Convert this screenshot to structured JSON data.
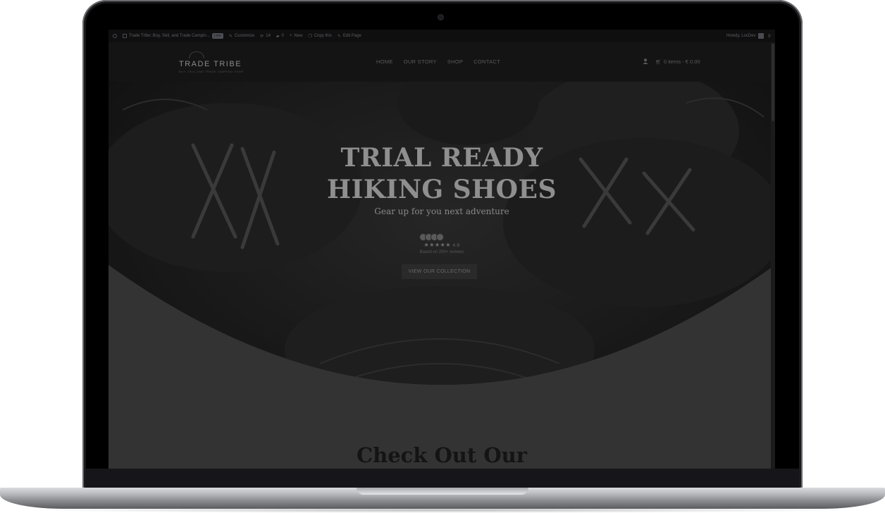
{
  "admin_bar": {
    "site_name": "Trade Tribe: Buy, Sell, and Trade Campin...",
    "live_badge": "Live",
    "customize": "Customize",
    "updates_count": "14",
    "comments_count": "0",
    "new": "New",
    "copy_this": "Copy this",
    "edit_page": "Edit Page",
    "howdy": "Howdy, LocDev"
  },
  "header": {
    "logo": "TRADE TRIBE",
    "tagline": "BUY, SELL AND TRADE CAMPING GEAR",
    "nav": [
      "HOME",
      "OUR STORY",
      "SHOP",
      "CONTACT"
    ],
    "cart": "0 items - € 0.00"
  },
  "hero": {
    "title_line1": "TRIAL READY",
    "title_line2": "HIKING SHOES",
    "subtitle": "Gear up for you next adventure",
    "stars": "★★★★★",
    "rating": "4.9",
    "reviews": "Based on 200+ reviews",
    "cta": "VIEW OUR COLLECTION"
  },
  "section": {
    "title": "Check Out Our"
  }
}
